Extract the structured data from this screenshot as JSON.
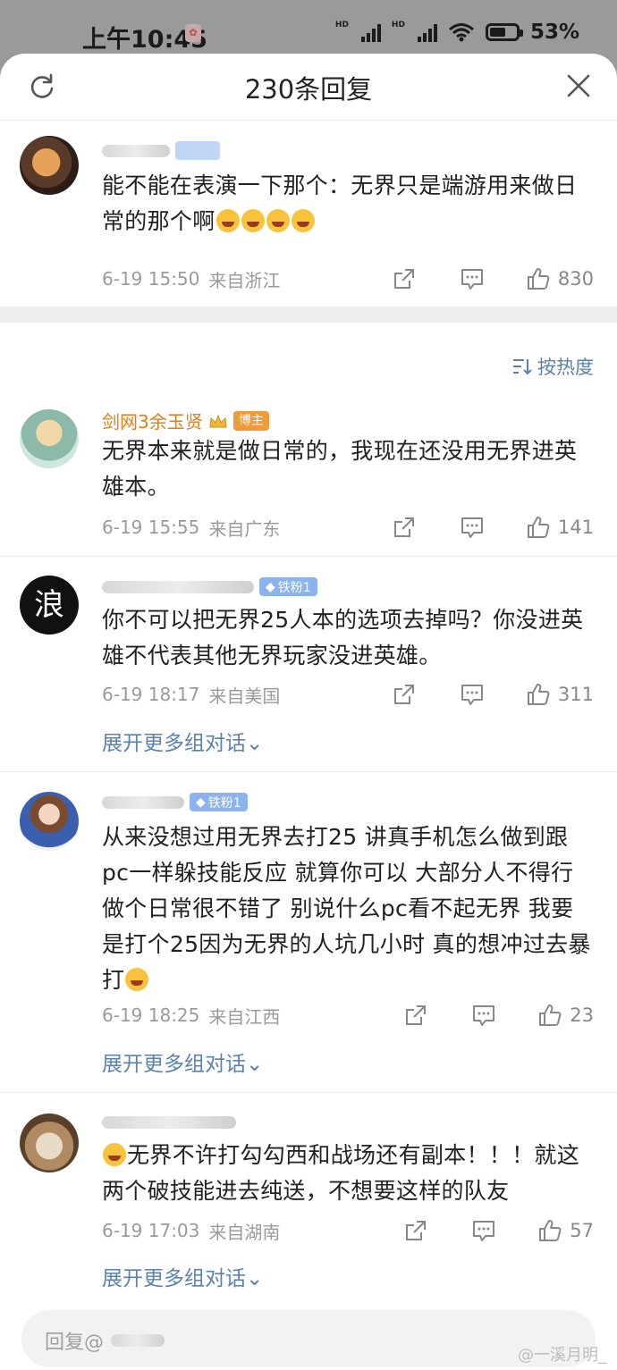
{
  "status": {
    "time": "上午10:45",
    "battery": "53%"
  },
  "header": {
    "title": "230条回复"
  },
  "sort_label": "按热度",
  "root": {
    "text": "能不能在表演一下那个：无界只是端游用来做日常的那个啊",
    "time": "6-19 15:50",
    "location": "来自浙江",
    "likes": "830"
  },
  "comments": [
    {
      "name": "剑网3余玉贤",
      "badge": "博主",
      "text": "无界本来就是做日常的，我现在还没用无界进英雄本。",
      "time": "6-19 15:55",
      "location": "来自广东",
      "likes": "141"
    },
    {
      "badge": "铁粉1",
      "text": "你不可以把无界25人本的选项去掉吗？你没进英雄不代表其他无界玩家没进英雄。",
      "time": "6-19 18:17",
      "location": "来自美国",
      "likes": "311",
      "expand": "展开更多组对话"
    },
    {
      "badge": "铁粉1",
      "text": "从来没想过用无界去打25 讲真手机怎么做到跟pc一样躲技能反应 就算你可以 大部分人不得行 做个日常很不错了 别说什么pc看不起无界 我要是打个25因为无界的人坑几小时 真的想冲过去暴打",
      "time": "6-19 18:25",
      "location": "来自江西",
      "likes": "23",
      "expand": "展开更多组对话"
    },
    {
      "text": "无界不许打勾勾西和战场还有副本！！！就这两个破技能进去纯送，不想要这样的队友",
      "time": "6-19 17:03",
      "location": "来自湖南",
      "likes": "57",
      "expand": "展开更多组对话"
    }
  ],
  "reply_placeholder": "回复@",
  "watermark": "@一溪月明_"
}
